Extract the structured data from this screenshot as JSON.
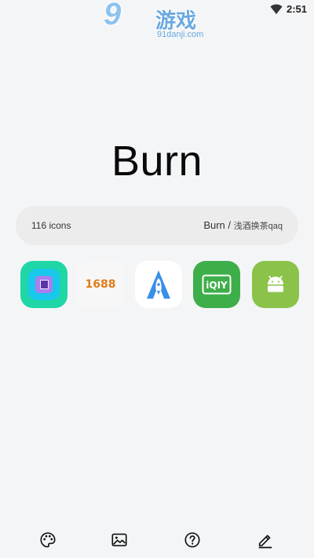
{
  "status": {
    "time": "2:51"
  },
  "watermark": {
    "number": "9",
    "cn": "游戏",
    "url": "91danji.com"
  },
  "pack": {
    "title": "Burn",
    "icon_count": "116 icons",
    "name": "Burn",
    "separator": " / ",
    "author": "浅酒换茶qaq"
  },
  "icons": {
    "app2_text": "1688",
    "app4_text": "iQIY"
  },
  "nav": {
    "items": [
      "palette",
      "wallpaper",
      "help",
      "edit"
    ]
  },
  "colors": {
    "background": "#f4f5f7",
    "pill": "#ececec",
    "iqiyi_green": "#3eae4a",
    "android_green": "#8bc34a"
  }
}
